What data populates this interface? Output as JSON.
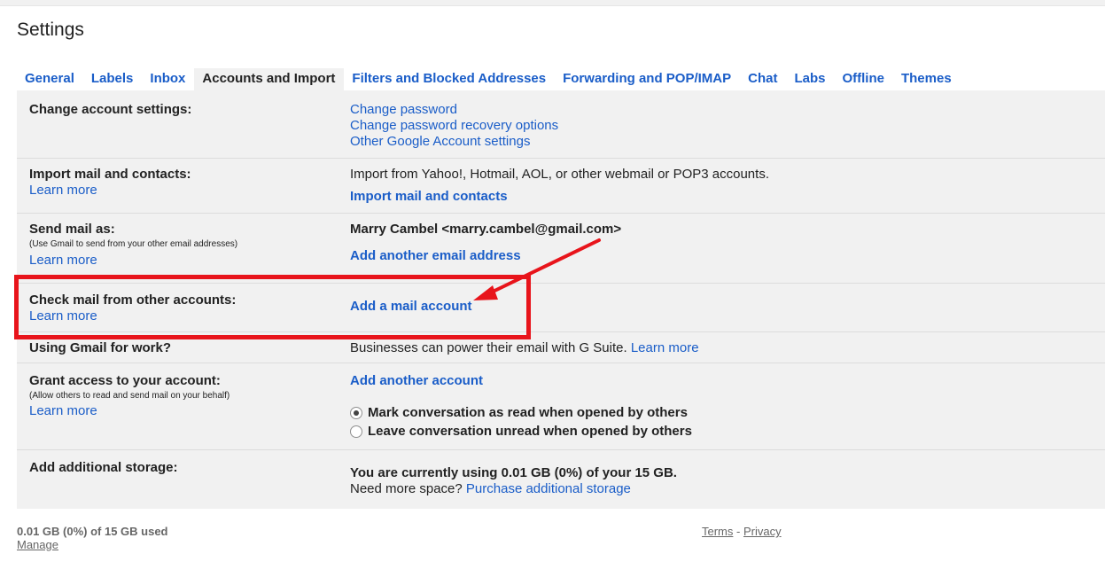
{
  "page": {
    "title": "Settings"
  },
  "tabs": [
    {
      "label": "General",
      "active": false
    },
    {
      "label": "Labels",
      "active": false
    },
    {
      "label": "Inbox",
      "active": false
    },
    {
      "label": "Accounts and Import",
      "active": true
    },
    {
      "label": "Filters and Blocked Addresses",
      "active": false
    },
    {
      "label": "Forwarding and POP/IMAP",
      "active": false
    },
    {
      "label": "Chat",
      "active": false
    },
    {
      "label": "Labs",
      "active": false
    },
    {
      "label": "Offline",
      "active": false
    },
    {
      "label": "Themes",
      "active": false
    }
  ],
  "rows": {
    "change_account": {
      "title": "Change account settings:",
      "links": [
        "Change password",
        "Change password recovery options",
        "Other Google Account settings"
      ]
    },
    "import_mail": {
      "title": "Import mail and contacts:",
      "learn_more": "Learn more",
      "description": "Import from Yahoo!, Hotmail, AOL, or other webmail or POP3 accounts.",
      "action": "Import mail and contacts"
    },
    "send_mail_as": {
      "title": "Send mail as:",
      "subtitle": "(Use Gmail to send from your other email addresses)",
      "learn_more": "Learn more",
      "address": "Marry Cambel <marry.cambel@gmail.com>",
      "action": "Add another email address"
    },
    "check_mail": {
      "title": "Check mail from other accounts:",
      "learn_more": "Learn more",
      "action": "Add a mail account"
    },
    "gmail_work": {
      "title": "Using Gmail for work?",
      "description": "Businesses can power their email with G Suite.",
      "learn_more": "Learn more"
    },
    "grant_access": {
      "title": "Grant access to your account:",
      "subtitle": "(Allow others to read and send mail on your behalf)",
      "learn_more": "Learn more",
      "action": "Add another account",
      "options": [
        {
          "label": "Mark conversation as read when opened by others",
          "checked": true
        },
        {
          "label": "Leave conversation unread when opened by others",
          "checked": false
        }
      ]
    },
    "storage": {
      "title": "Add additional storage:",
      "usage": "You are currently using 0.01 GB (0%) of your 15 GB.",
      "need_more": "Need more space?",
      "purchase": "Purchase additional storage"
    }
  },
  "footer": {
    "usage": "0.01 GB (0%) of 15 GB used",
    "manage": "Manage",
    "terms": "Terms",
    "separator": "-",
    "privacy": "Privacy"
  },
  "annotation": {
    "box_color": "#e8141b"
  }
}
